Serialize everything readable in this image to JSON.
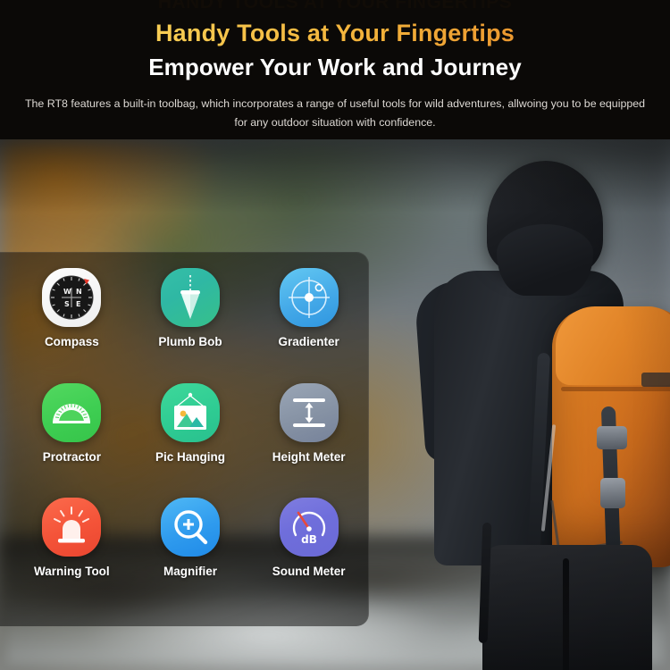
{
  "header": {
    "eyebrow": "HANDY TOOLS AT YOUR FINGERTIPS",
    "title": "Handy Tools at Your Fingertips",
    "subtitle": "Empower Your Work and Journey",
    "paragraph": "The RT8 features a built-in toolbag, which incorporates a range of useful tools for wild adventures, allwoing you to be equipped for any outdoor situation with confidence.",
    "title_gradient_start": "#f5c23a",
    "title_gradient_end": "#e07d22",
    "subtitle_color": "#ffffff",
    "paragraph_color": "#ddd9d4",
    "background_color": "#0b0907"
  },
  "tools": [
    {
      "label": "Compass",
      "icon": "compass-icon",
      "tile_color": "#fdfdfd"
    },
    {
      "label": "Plumb Bob",
      "icon": "plumb-bob-icon",
      "tile_color": "#35bfa8"
    },
    {
      "label": "Gradienter",
      "icon": "gradienter-icon",
      "tile_color": "#44a9e8"
    },
    {
      "label": "Protractor",
      "icon": "protractor-icon",
      "tile_color": "#3ece52"
    },
    {
      "label": "Pic Hanging",
      "icon": "pic-hanging-icon",
      "tile_color": "#2fcc93"
    },
    {
      "label": "Height Meter",
      "icon": "height-meter-icon",
      "tile_color": "#8692a4"
    },
    {
      "label": "Warning Tool",
      "icon": "warning-tool-icon",
      "tile_color": "#f45338"
    },
    {
      "label": "Magnifier",
      "icon": "magnifier-icon",
      "tile_color": "#2f9bee"
    },
    {
      "label": "Sound Meter",
      "icon": "sound-meter-icon",
      "tile_color": "#6f6edb"
    }
  ],
  "compass_marks": {
    "north": "N",
    "west": "W",
    "east": "E",
    "south": "S"
  },
  "sound_meter": {
    "unit_label": "dB",
    "needle_color": "#e8493a"
  },
  "photo": {
    "description": "Hiker wearing black hooded jacket with orange backpack walking beside a river in an autumn forest"
  }
}
